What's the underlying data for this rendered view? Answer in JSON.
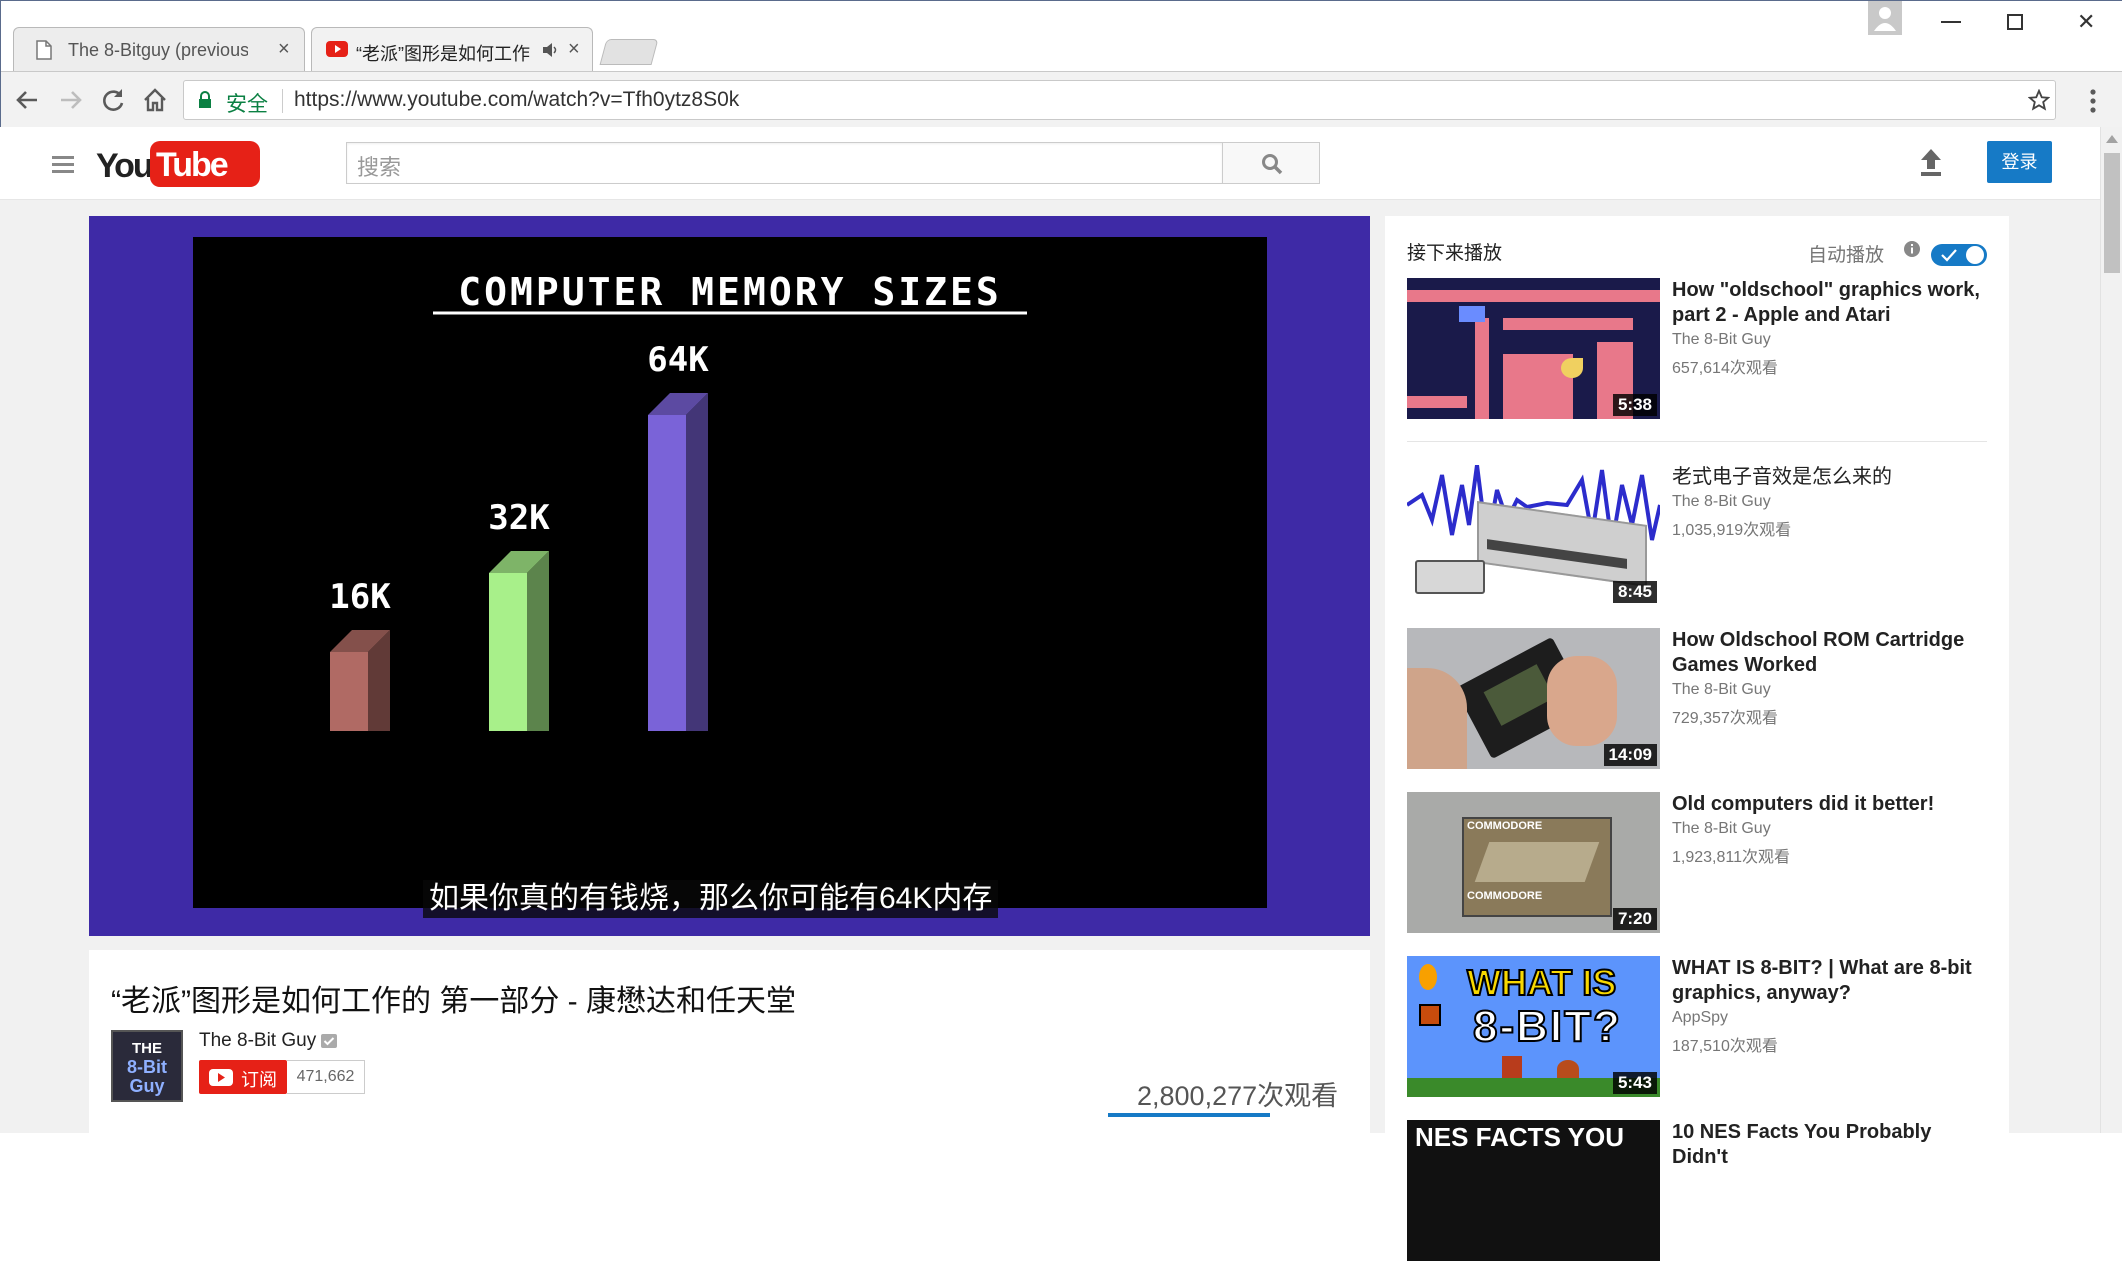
{
  "browser": {
    "tabs": [
      {
        "title": "The 8-Bitguy (previous",
        "close": "×"
      },
      {
        "title": "“老派”图形是如何工作",
        "close": "×"
      }
    ],
    "secure_label": "安全",
    "url": "https://www.youtube.com/watch?v=Tfh0ytz8S0k",
    "window_min": "—",
    "window_close": "✕"
  },
  "youtube": {
    "logo_you": "You",
    "logo_tube": "Tube",
    "search_placeholder": "搜索",
    "signin_label": "登录"
  },
  "video": {
    "screen_title": "COMPUTER MEMORY SIZES",
    "subtitle": "如果你真的有钱烧，那么你可能有64K内存",
    "title": "“老派”图形是如何工作的 第一部分 - 康懋达和任天堂",
    "channel": "The 8-Bit Guy",
    "channel_avatar_text": [
      "THE",
      "8-Bit",
      "Guy"
    ],
    "subscribe_label": "订阅",
    "subscriber_count": "471,662",
    "view_count": "2,800,277次观看"
  },
  "chart_data": {
    "type": "bar",
    "title": "COMPUTER MEMORY SIZES",
    "categories": [
      "16K",
      "32K",
      "64K"
    ],
    "values": [
      16,
      32,
      64
    ],
    "colors": [
      "#b06a64",
      "#a8f08a",
      "#7a63d8"
    ]
  },
  "sidebar": {
    "up_next": "接下来播放",
    "autoplay": "自动播放",
    "recommendations": [
      {
        "title": "How \"oldschool\" graphics work, part 2 - Apple and Atari",
        "channel": "The 8-Bit Guy",
        "views": "657,614次观看",
        "duration": "5:38"
      },
      {
        "title": "老式电子音效是怎么来的",
        "channel": "The 8-Bit Guy",
        "views": "1,035,919次观看",
        "duration": "8:45"
      },
      {
        "title": "How Oldschool ROM Cartridge Games Worked",
        "channel": "The 8-Bit Guy",
        "views": "729,357次观看",
        "duration": "14:09"
      },
      {
        "title": "Old computers did it better!",
        "channel": "The 8-Bit Guy",
        "views": "1,923,811次观看",
        "duration": "7:20"
      },
      {
        "title": "WHAT IS 8-BIT? | What are 8-bit graphics, anyway?",
        "channel": "AppSpy",
        "views": "187,510次观看",
        "duration": "5:43"
      },
      {
        "title": "10 NES Facts You Probably Didn't",
        "channel": "",
        "views": "",
        "duration": ""
      }
    ],
    "thumb_texts": {
      "what_is": "WHAT IS",
      "eight_bit": "8-BIT?",
      "commodore": "COMMODORE",
      "nes_facts": "NES FACTS YOU"
    }
  },
  "colors": {
    "accent_blue": "#167ac6",
    "youtube_red": "#e62117",
    "secure_green": "#0b8043",
    "player_border": "#3e2aa6"
  }
}
